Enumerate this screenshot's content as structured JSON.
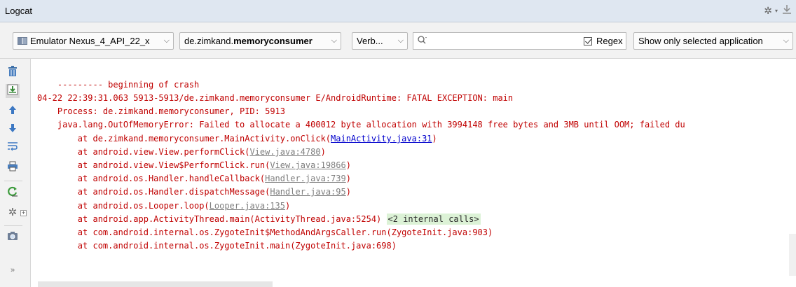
{
  "title": "Logcat",
  "toolbar": {
    "device": "Emulator Nexus_4_API_22_x",
    "process_prefix": "de.zimkand.",
    "process_bold": "memoryconsumer",
    "level": "Verb...",
    "search_value": "",
    "regex_label": "Regex",
    "filter": "Show only selected application"
  },
  "icons": {
    "title_gear": "gear-icon",
    "title_pin": "hide-icon",
    "sidebar": [
      "trash-icon",
      "scroll-to-end-icon",
      "up-arrow-icon",
      "down-arrow-icon",
      "soft-wrap-icon",
      "print-icon",
      "restart-icon",
      "settings-icon",
      "screenshot-icon",
      "more-icon"
    ]
  },
  "log": {
    "lines": [
      {
        "text": "    --------- beginning of crash"
      },
      {
        "text": "04-22 22:39:31.063 5913-5913/de.zimkand.memoryconsumer E/AndroidRuntime: FATAL EXCEPTION: main"
      },
      {
        "text": "    Process: de.zimkand.memoryconsumer, PID: 5913"
      },
      {
        "text": "    java.lang.OutOfMemoryError: Failed to allocate a 400012 byte allocation with 3994148 free bytes and 3MB until OOM; failed du"
      },
      {
        "text": "        at de.zimkand.memoryconsumer.MainActivity.onClick(",
        "link": "MainActivity.java:31",
        "link_style": "link",
        "suffix": ")"
      },
      {
        "text": "        at android.view.View.performClick(",
        "link": "View.java:4780",
        "link_style": "gray",
        "suffix": ")"
      },
      {
        "text": "        at android.view.View$PerformClick.run(",
        "link": "View.java:19866",
        "link_style": "gray",
        "suffix": ")"
      },
      {
        "text": "        at android.os.Handler.handleCallback(",
        "link": "Handler.java:739",
        "link_style": "gray",
        "suffix": ")"
      },
      {
        "text": "        at android.os.Handler.dispatchMessage(",
        "link": "Handler.java:95",
        "link_style": "gray",
        "suffix": ")"
      },
      {
        "text": "        at android.os.Looper.loop(",
        "link": "Looper.java:135",
        "link_style": "gray",
        "suffix": ")"
      },
      {
        "text": "        at android.app.ActivityThread.main(ActivityThread.java:5254) ",
        "badge": "<2 internal calls>"
      },
      {
        "text": "        at com.android.internal.os.ZygoteInit$MethodAndArgsCaller.run(ZygoteInit.java:903)"
      },
      {
        "text": "        at com.android.internal.os.ZygoteInit.main(ZygoteInit.java:698)"
      }
    ]
  }
}
